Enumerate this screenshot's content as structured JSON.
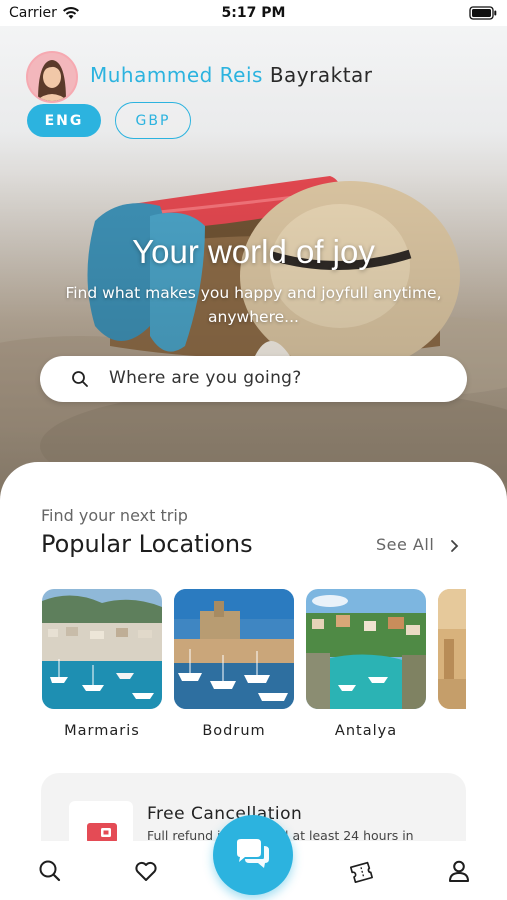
{
  "status_bar": {
    "carrier": "Carrier",
    "time": "5:17 PM"
  },
  "user": {
    "first_name": "Muhammed Reis",
    "last_name": "Bayraktar"
  },
  "settings": {
    "language": "ENG",
    "currency": "GBP"
  },
  "hero": {
    "title": "Your world of joy",
    "subtitle": "Find what makes you happy and joyfull anytime, anywhere...",
    "search_placeholder": "Where are you going?"
  },
  "popular": {
    "subtitle": "Find your next trip",
    "title": "Popular Locations",
    "see_all": "See All",
    "locations": [
      {
        "name": "Marmaris"
      },
      {
        "name": "Bodrum"
      },
      {
        "name": "Antalya"
      }
    ]
  },
  "promo": {
    "title": "Free Cancellation",
    "description": "Full refund if cancelled at least 24 hours in"
  },
  "tabs": [
    "search-icon",
    "heart-icon",
    "chat-icon",
    "tickets-icon",
    "profile-icon"
  ],
  "colors": {
    "accent": "#2cb3df",
    "card": "#f3f3f3"
  }
}
